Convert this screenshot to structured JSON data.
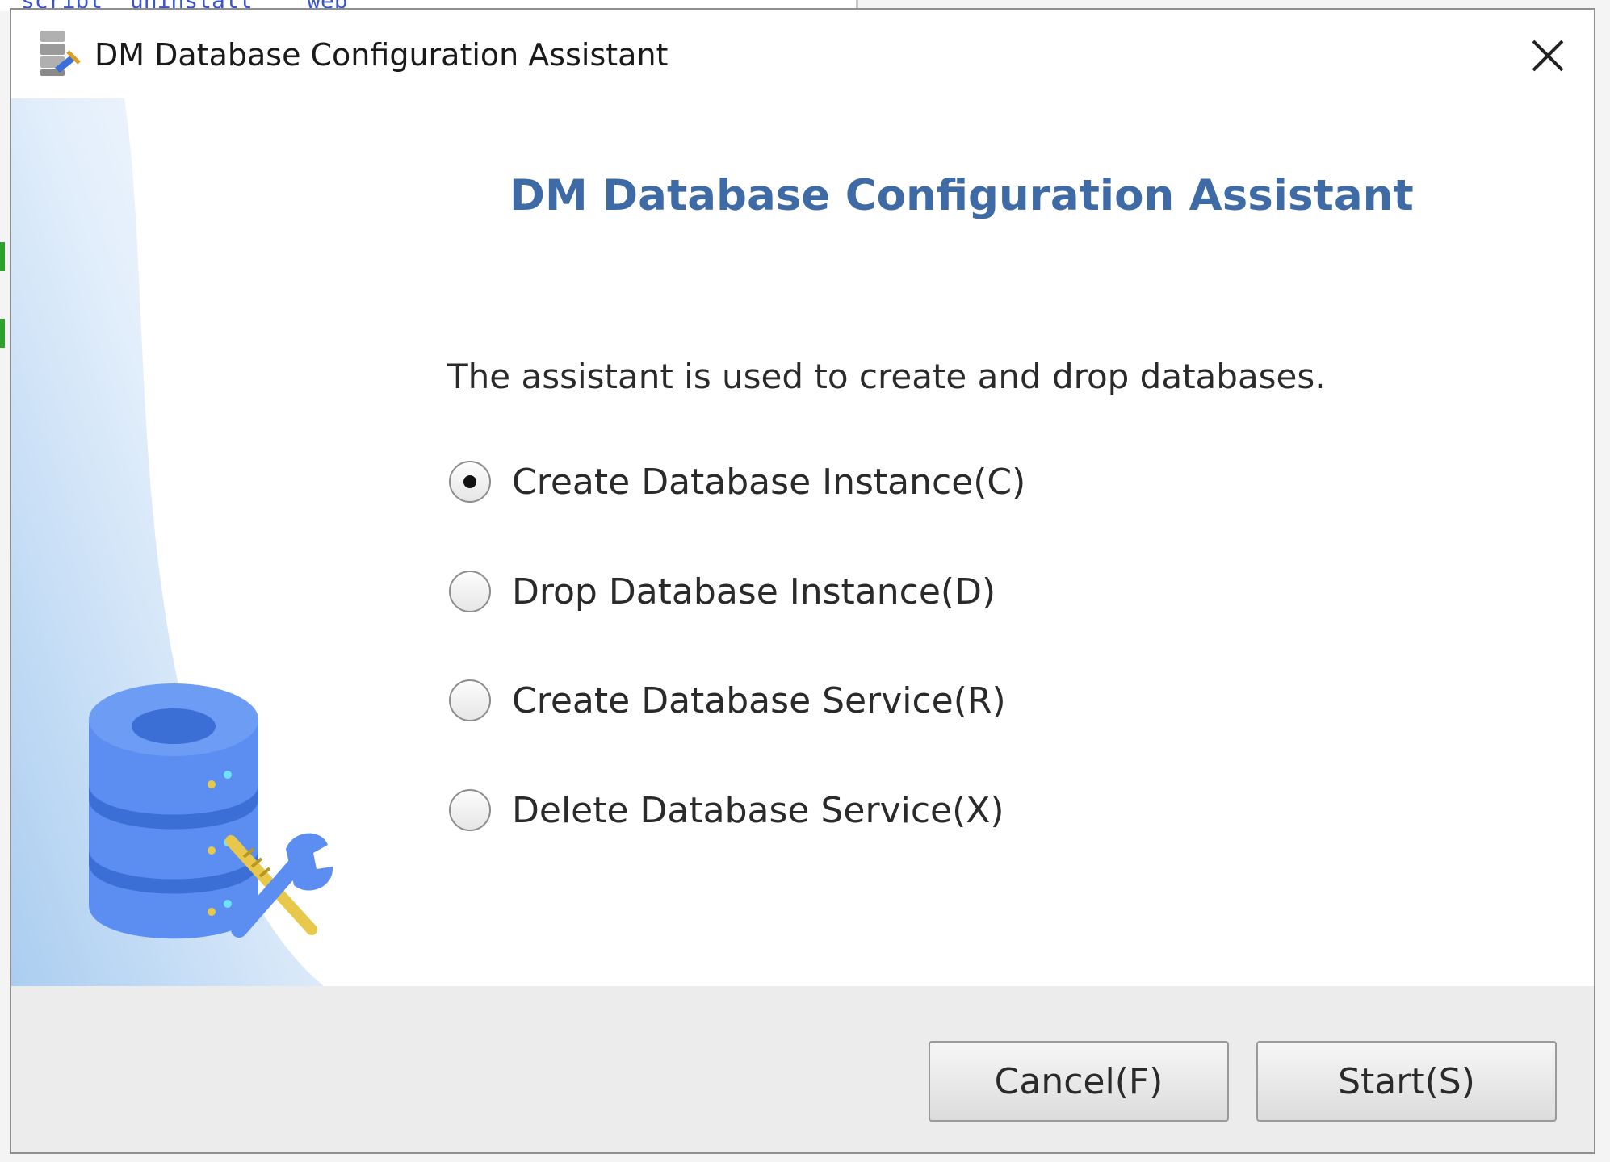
{
  "background": {
    "partial_text": "script  uninstall    web"
  },
  "dialog": {
    "title": "DM Database Configuration Assistant",
    "heading": "DM Database Configuration Assistant",
    "description": "The assistant is used to create and drop databases.",
    "options": [
      {
        "label": "Create Database Instance(C)",
        "selected": true
      },
      {
        "label": "Drop Database Instance(D)",
        "selected": false
      },
      {
        "label": "Create Database Service(R)",
        "selected": false
      },
      {
        "label": "Delete Database Service(X)",
        "selected": false
      }
    ],
    "buttons": {
      "cancel": "Cancel(F)",
      "start": "Start(S)"
    }
  },
  "colors": {
    "heading": "#3e6aa6",
    "illustration_blue": "#5b8ef0",
    "illustration_dark_blue": "#3b6fd6",
    "tool_yellow": "#e8c84a"
  },
  "icons": {
    "app": "database-config-icon",
    "close": "close-icon",
    "illustration": "database-tools-illustration"
  }
}
